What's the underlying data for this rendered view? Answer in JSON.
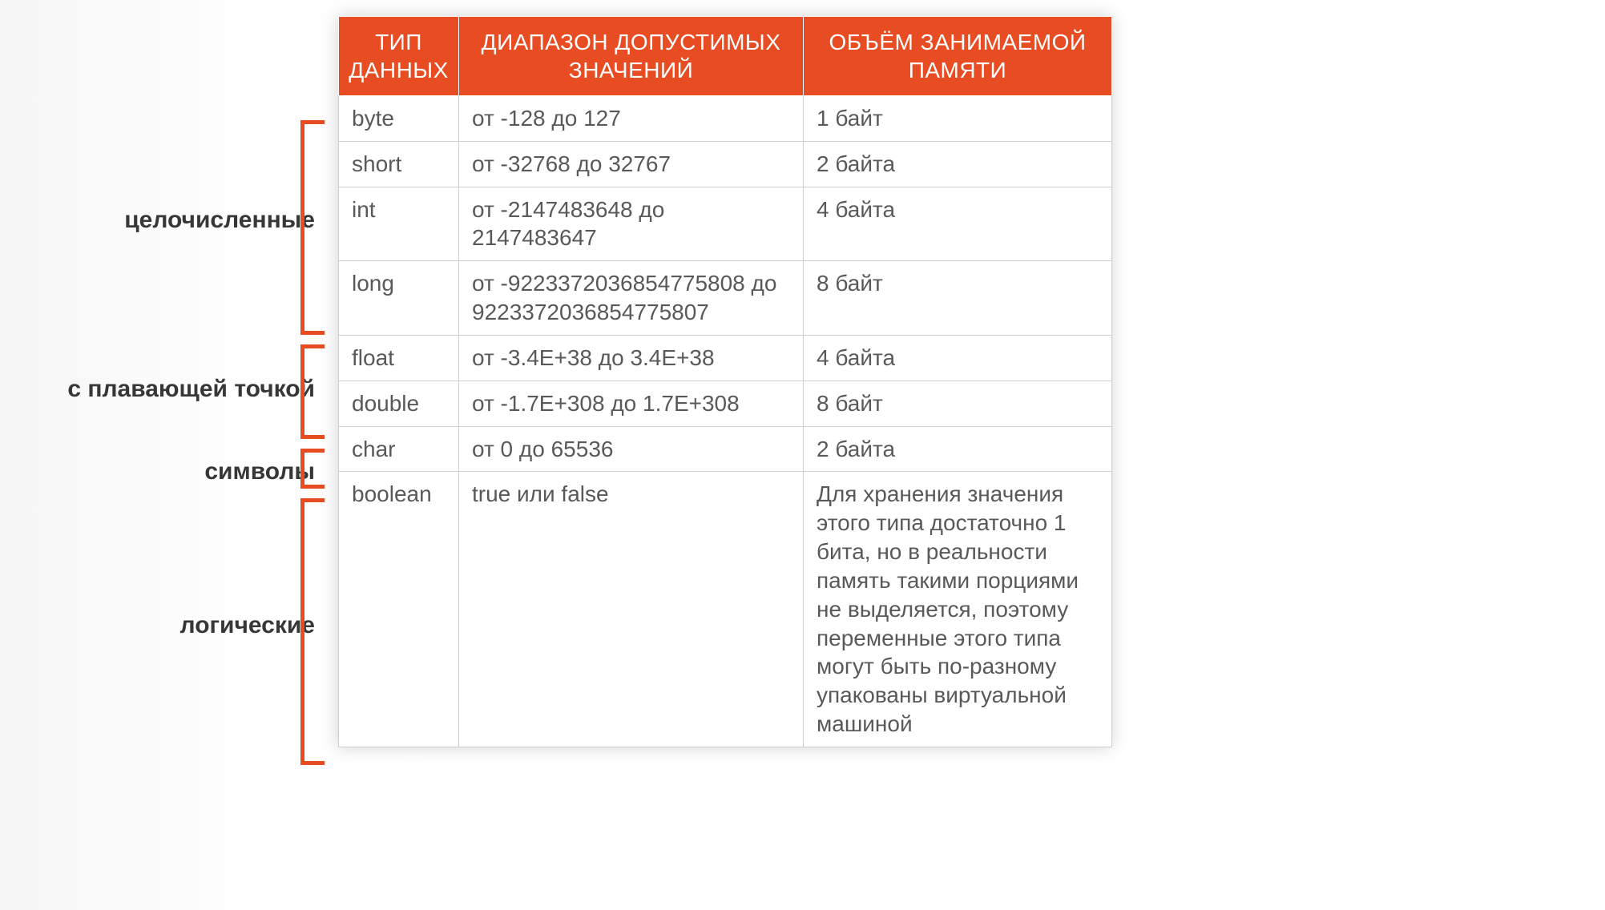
{
  "headers": {
    "type": "ТИП ДАННЫХ",
    "range": "ДИАПАЗОН ДОПУСТИМЫХ ЗНАЧЕНИЙ",
    "memory": "ОБЪЁМ ЗАНИМАЕМОЙ ПАМЯТИ"
  },
  "categories": {
    "integer": "целочисленные",
    "float": "с плавающей точкой",
    "char": "символы",
    "bool": "логические"
  },
  "rows": [
    {
      "type": "byte",
      "range": "от -128 до 127",
      "memory": "1 байт"
    },
    {
      "type": "short",
      "range": "от -32768 до 32767",
      "memory": "2 байта"
    },
    {
      "type": "int",
      "range": "от -2147483648 до 2147483647",
      "memory": "4 байта"
    },
    {
      "type": "long",
      "range": "от -9223372036854775808 до 9223372036854775807",
      "memory": "8 байт"
    },
    {
      "type": "float",
      "range": "от -3.4E+38 до 3.4E+38",
      "memory": "4 байта"
    },
    {
      "type": "double",
      "range": "от -1.7E+308 до 1.7E+308",
      "memory": "8 байт"
    },
    {
      "type": "char",
      "range": "от 0 до 65536",
      "memory": "2 байта"
    },
    {
      "type": "boolean",
      "range": "true или false",
      "memory": "Для хранения значения этого типа достаточно 1 бита, но в реальности память такими порциями не выделяется, поэтому переменные этого типа могут быть по-разному упакованы виртуальной машиной"
    }
  ]
}
